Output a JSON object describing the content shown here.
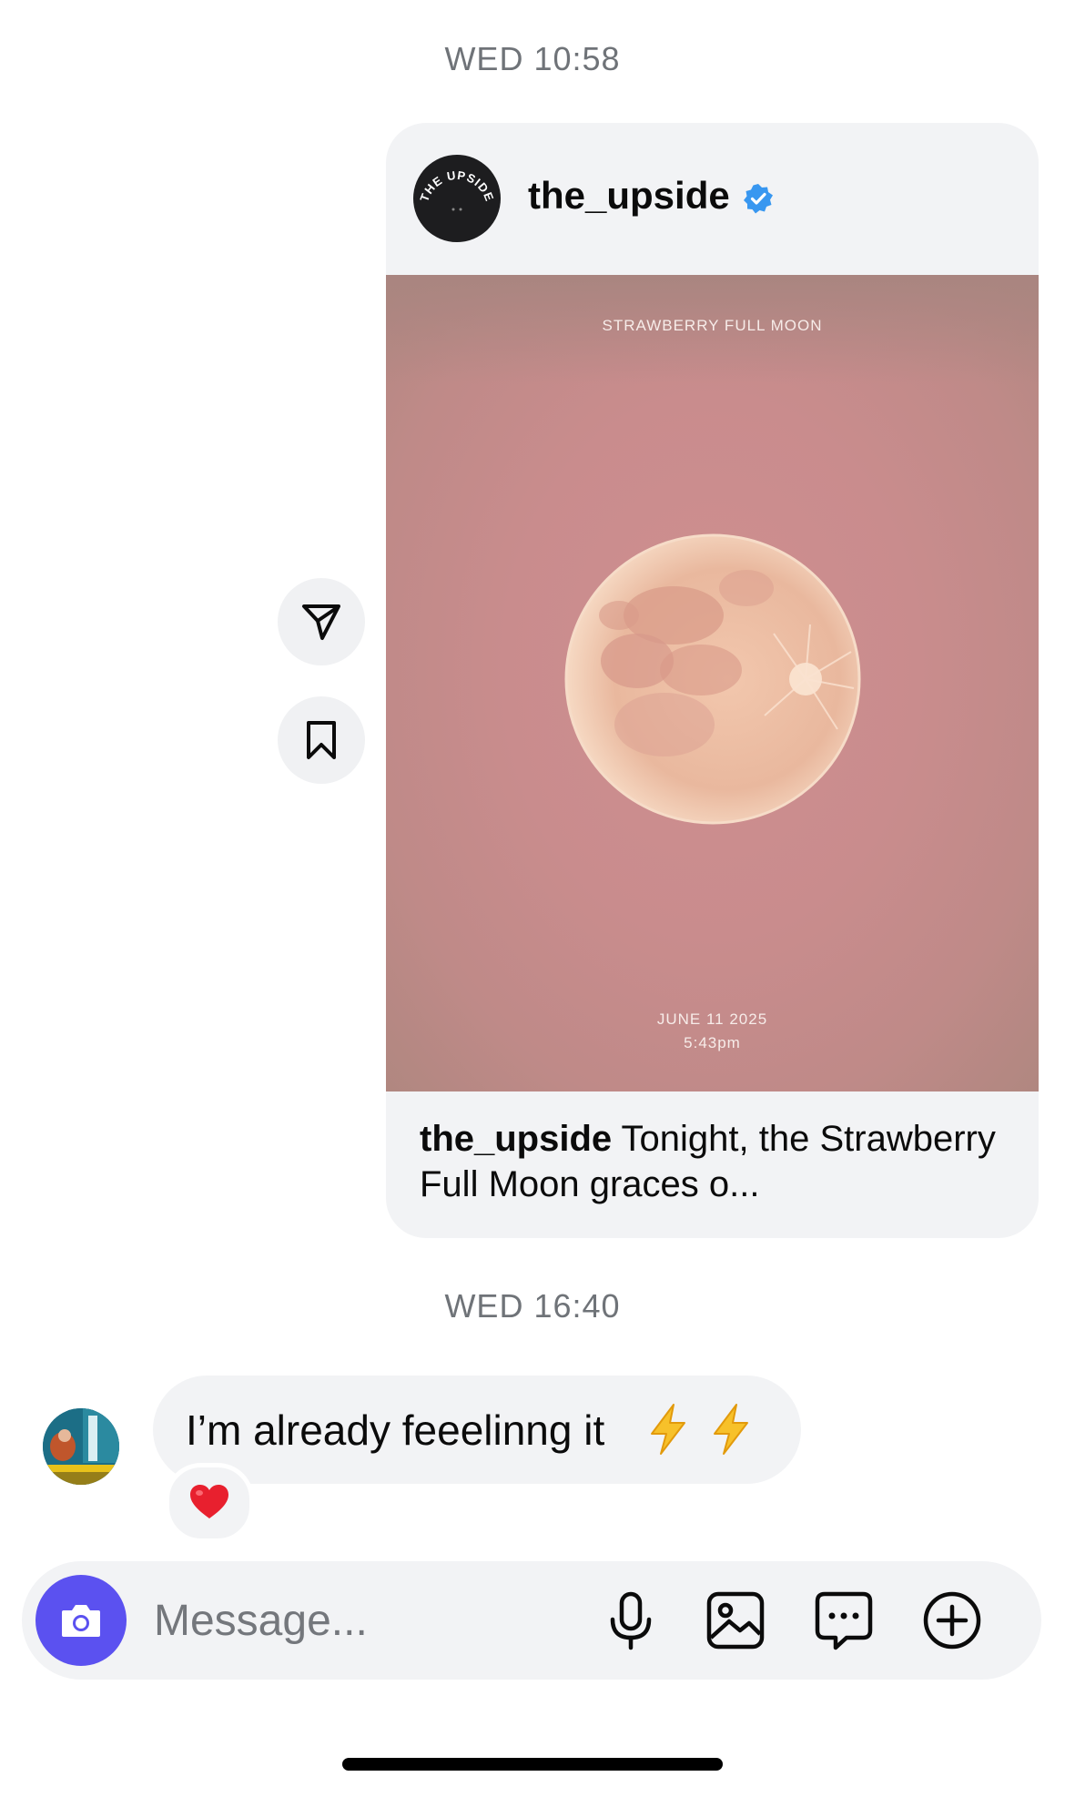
{
  "thread": {
    "timestamp_1": "WED 10:58",
    "timestamp_2": "WED 16:40"
  },
  "shared_post": {
    "username": "the_upside",
    "avatar_text": "THE UPSIDE",
    "verified": true,
    "image": {
      "title_text": "STRAWBERRY FULL MOON",
      "date_text": "JUNE 11 2025",
      "time_text": "5:43pm"
    },
    "caption_user": "the_upside",
    "caption_text": " Tonight, the Strawberry Full Moon graces o..."
  },
  "side_actions": {
    "share_icon": "paper-plane-icon",
    "save_icon": "bookmark-icon"
  },
  "incoming_message": {
    "text": "I’m already feeelinng it",
    "emojis": [
      "high-voltage",
      "high-voltage"
    ],
    "reaction": "red-heart"
  },
  "composer": {
    "placeholder": "Message...",
    "value": "",
    "icons": [
      "camera-icon",
      "microphone-icon",
      "gallery-icon",
      "sticker-icon",
      "add-icon"
    ]
  },
  "colors": {
    "accent": "#5b51f0",
    "verified_blue": "#3897f0",
    "bubble_bg": "#f2f3f5",
    "timestamp": "#6f7378"
  }
}
